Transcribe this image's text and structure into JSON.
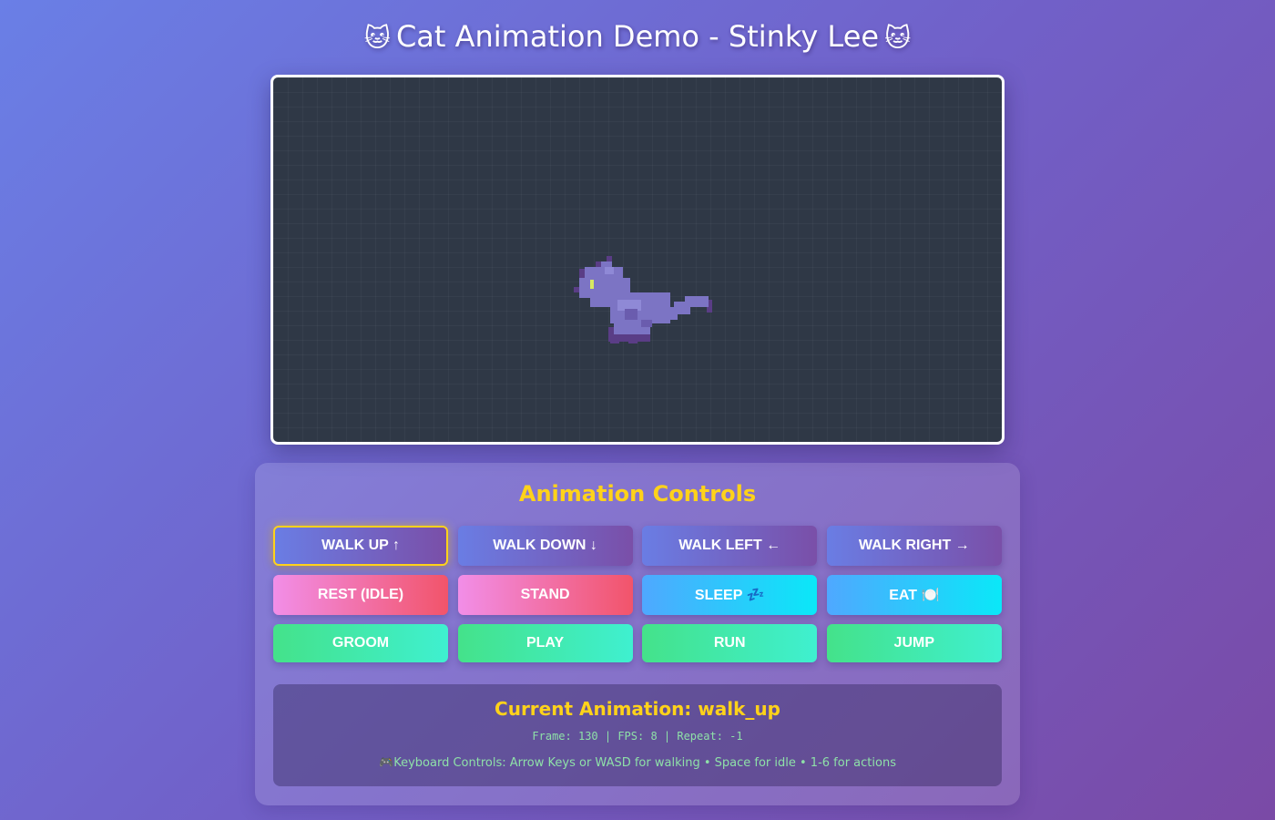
{
  "header": {
    "title": "Cat Animation Demo - Stinky Lee",
    "emoji_left": "🐱",
    "emoji_right": "🐱"
  },
  "stage": {
    "background": "#2f3846",
    "sprite": "cat-sprite-icon"
  },
  "controls": {
    "title": "Animation Controls",
    "buttons": [
      {
        "label": "WALK UP ↑",
        "active": true
      },
      {
        "label": "WALK DOWN ↓"
      },
      {
        "label": "WALK LEFT ←"
      },
      {
        "label": "WALK RIGHT →"
      },
      {
        "label": "REST (IDLE)"
      },
      {
        "label": "STAND"
      },
      {
        "label": "SLEEP 💤"
      },
      {
        "label": "EAT 🍽️"
      },
      {
        "label": "GROOM"
      },
      {
        "label": "PLAY"
      },
      {
        "label": "RUN"
      },
      {
        "label": "JUMP"
      }
    ]
  },
  "status": {
    "current": "Current Animation: walk_up",
    "frame_info": "Frame: 130 | FPS: 8 | Repeat: -1",
    "keyboard_icon": "🎮",
    "keyboard_text": "Keyboard Controls: Arrow Keys or WASD for walking • Space for idle • 1-6 for actions"
  },
  "colors": {
    "accent": "#ffd21a",
    "info_text": "#8ee0a8",
    "cat_body": "#7c74c4",
    "cat_outline": "#5a3d86",
    "cat_eye": "#d8e860"
  }
}
